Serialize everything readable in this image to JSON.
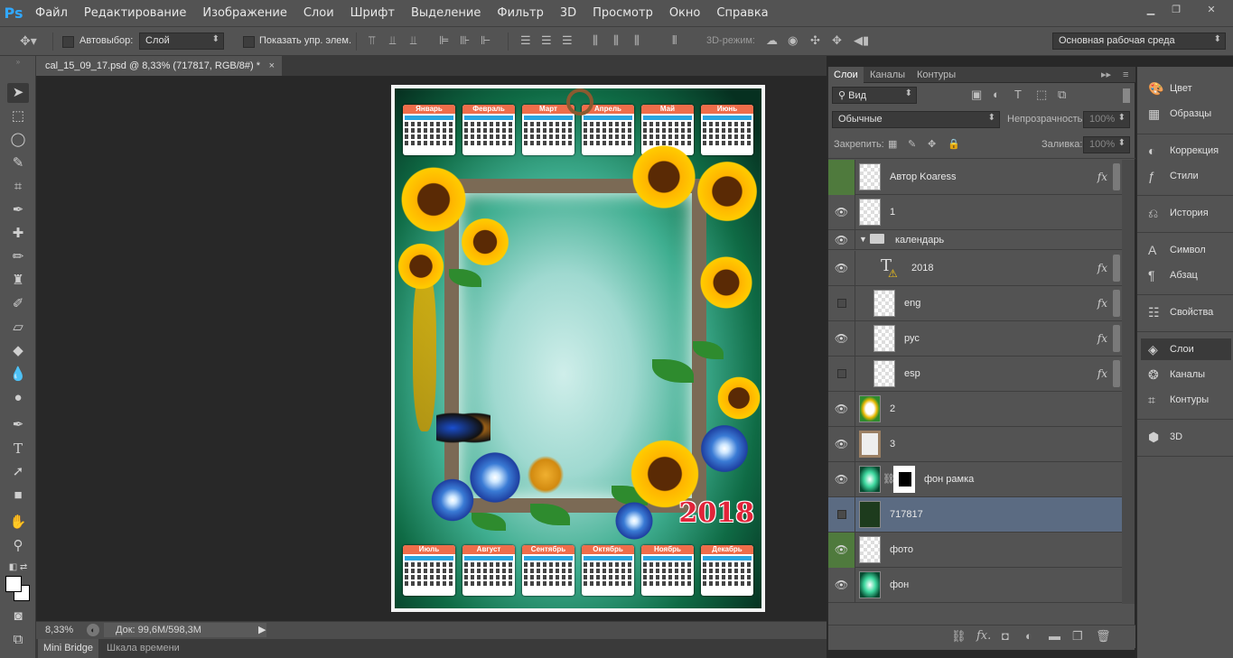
{
  "app": {
    "logo": "Ps"
  },
  "menu": [
    "Файл",
    "Редактирование",
    "Изображение",
    "Слои",
    "Шрифт",
    "Выделение",
    "Фильтр",
    "3D",
    "Просмотр",
    "Окно",
    "Справка"
  ],
  "options": {
    "autoselect_label": "Автовыбор:",
    "autoselect_value": "Слой",
    "show_transform_label": "Показать упр. элем.",
    "mode3d_label": "3D-режим:",
    "workspace": "Основная рабочая среда"
  },
  "document": {
    "tab_title": "cal_15_09_17.psd @ 8,33% (717817, RGB/8#) *",
    "close_icon": "×"
  },
  "status": {
    "zoom": "8,33%",
    "doc_info": "Док: 99,6M/598,3M"
  },
  "bottom_tabs": [
    "Mini Bridge",
    "Шкала времени"
  ],
  "artwork": {
    "months_top": [
      "Январь",
      "Февраль",
      "Март",
      "Апрель",
      "Май",
      "Июнь"
    ],
    "months_bottom": [
      "Июль",
      "Август",
      "Сентябрь",
      "Октябрь",
      "Ноябрь",
      "Декабрь"
    ],
    "year": "2018"
  },
  "layers_panel": {
    "tabs": [
      "Слои",
      "Каналы",
      "Контуры"
    ],
    "filter_kind": "Вид",
    "blend_mode": "Обычные",
    "opacity_label": "Непрозрачность:",
    "opacity_value": "100%",
    "lock_label": "Закрепить:",
    "fill_label": "Заливка:",
    "fill_value": "100%",
    "layers": [
      {
        "name": "Автор Koaress",
        "visible": false,
        "fx": true
      },
      {
        "name": "1",
        "visible": true,
        "fx": false
      },
      {
        "name": "календарь",
        "visible": true,
        "group": true
      },
      {
        "name": "2018",
        "visible": true,
        "fx": true,
        "text": true
      },
      {
        "name": "eng",
        "visible": false,
        "fx": true
      },
      {
        "name": "рус",
        "visible": true,
        "fx": true
      },
      {
        "name": "esp",
        "visible": false,
        "fx": true
      },
      {
        "name": "2",
        "visible": true
      },
      {
        "name": "3",
        "visible": true
      },
      {
        "name": "фон рамка",
        "visible": true
      },
      {
        "name": "717817",
        "visible": false,
        "selected": true
      },
      {
        "name": "фото",
        "visible": true
      },
      {
        "name": "фон",
        "visible": true
      }
    ]
  },
  "dock": [
    "Цвет",
    "Образцы",
    "Коррекция",
    "Стили",
    "История",
    "Символ",
    "Абзац",
    "Свойства",
    "Слои",
    "Каналы",
    "Контуры",
    "3D"
  ]
}
